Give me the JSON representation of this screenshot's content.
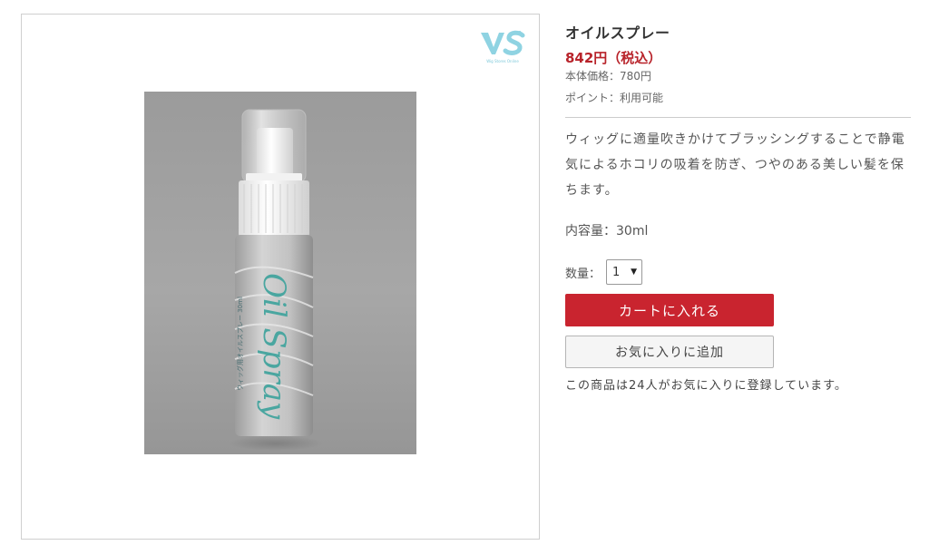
{
  "logo": {
    "mark": "VS",
    "subtext": "Wig Stores Online"
  },
  "product": {
    "name": "オイルスプレー",
    "price": "842円（税込）",
    "base_price": "本体価格：780円",
    "points": "ポイント：利用可能",
    "description": "ウィッグに適量吹きかけてブラッシングすることで静電気によるホコリの吸着を防ぎ、つやのある美しい髪を保ちます。",
    "capacity": "内容量：30ml"
  },
  "photo": {
    "brand_text": "Oil Spray",
    "side_text": "ウィッグ用オイルスプレー 30ml",
    "colors": {
      "background": "#a3a3a3",
      "bottle": "#c9c9c9",
      "lettering": "#4aa6a0"
    }
  },
  "purchase": {
    "quantity_label": "数量：",
    "quantity_value": "1",
    "cart_button": "カートに入れる",
    "favorite_button": "お気に入りに追加",
    "favorite_count_text": "この商品は24人がお気に入りに登録しています。"
  },
  "colors": {
    "price": "#b8232a",
    "cart_button": "#c9242f",
    "logo": "#7ec9da"
  }
}
